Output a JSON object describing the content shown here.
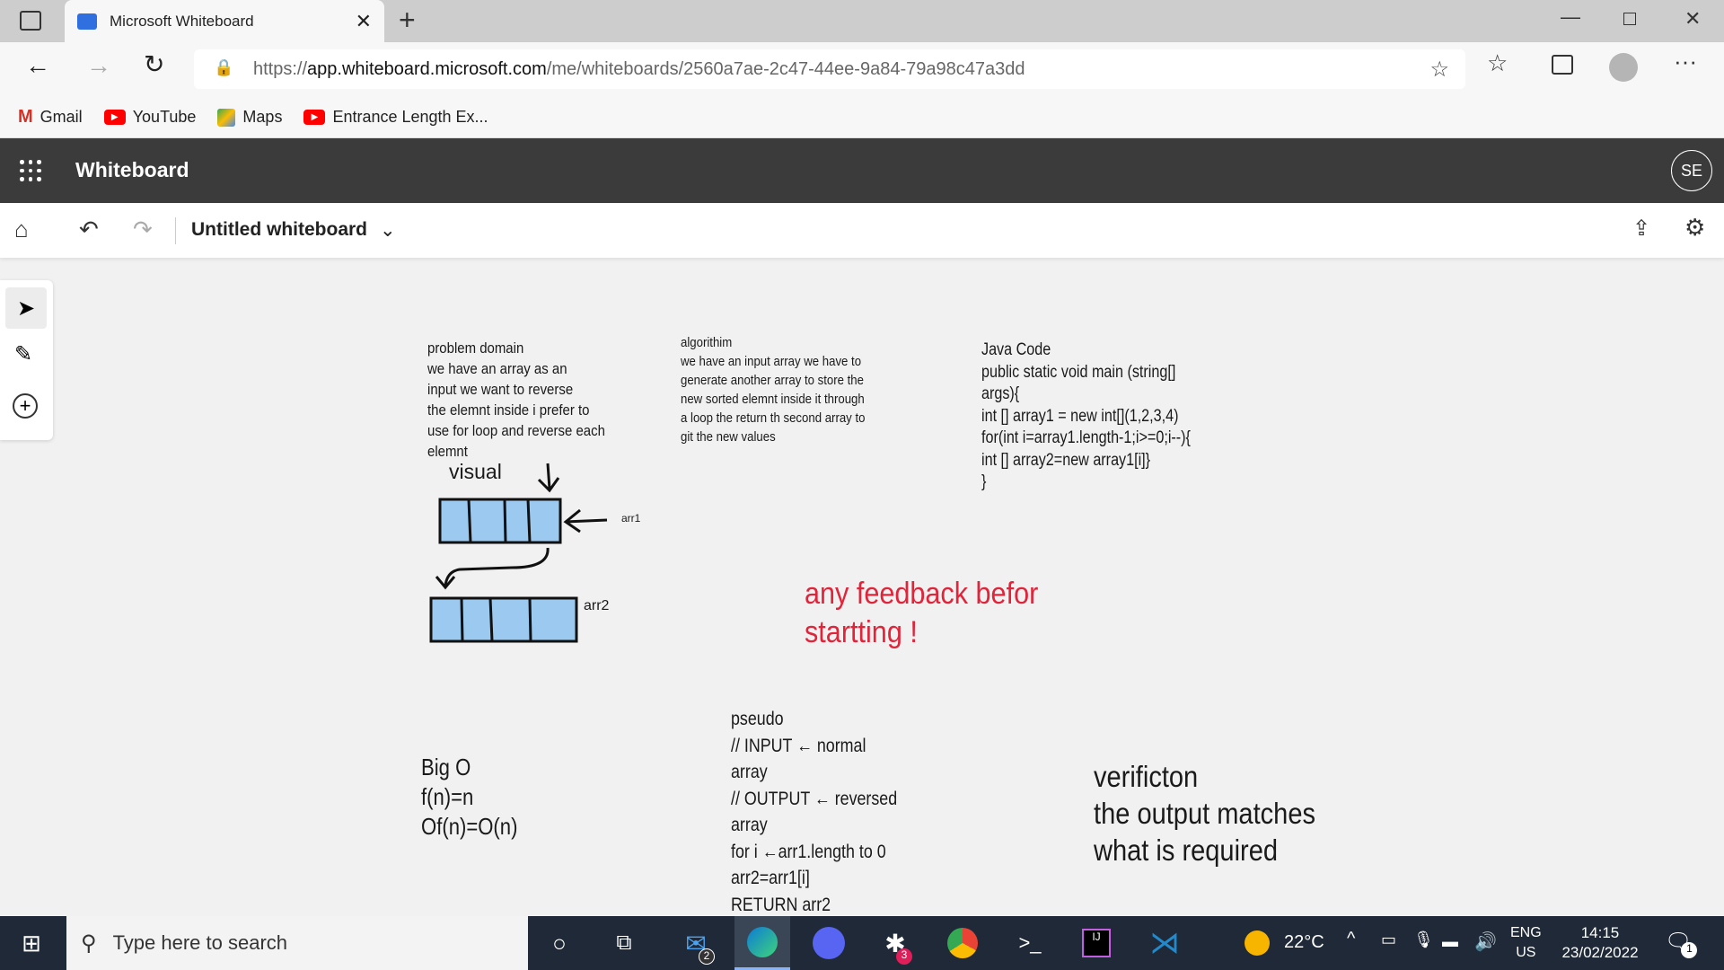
{
  "browser": {
    "tab_title": "Microsoft Whiteboard",
    "url_prefix": "https://",
    "url_host": "app.whiteboard.microsoft.com",
    "url_path": "/me/whiteboards/2560a7ae-2c47-44ee-9a84-79a98c47a3dd",
    "bookmarks": [
      {
        "label": "Gmail",
        "icon": "gmail-icon"
      },
      {
        "label": "YouTube",
        "icon": "youtube-icon"
      },
      {
        "label": "Maps",
        "icon": "maps-icon"
      },
      {
        "label": "Entrance Length Ex...",
        "icon": "youtube-icon"
      }
    ]
  },
  "app": {
    "name": "Whiteboard",
    "avatar": "SE",
    "board_title": "Untitled whiteboard"
  },
  "canvas": {
    "problem": [
      "problem domain",
      "we have an array as an",
      "input we want to reverse",
      "the elemnt inside i prefer to",
      "use for loop and reverse each",
      "elemnt"
    ],
    "algorithm": [
      "algorithim",
      "we have an input array we have to",
      "generate another array to store the",
      "new sorted elemnt inside it through",
      "a loop the return th second array to",
      "git the new values"
    ],
    "java": [
      "Java Code",
      "public static void main (string[]",
      "args){",
      "int [] array1 = new int[](1,2,3,4)",
      "for(int i=array1.length-1;i>=0;i--){",
      "int [] array2=new array1[i]}",
      "}"
    ],
    "visual_label": "visual",
    "arr1_label": "arr1",
    "arr2_label": "arr2",
    "feedback": [
      "any feedback befor",
      "startting !"
    ],
    "feedback_color": "#e0243a",
    "pseudo": [
      "pseudo",
      "// INPUT ← normal",
      "array",
      "// OUTPUT ← reversed",
      "array",
      "for i ←arr1.length to 0",
      "arr2=arr1[i]",
      "RETURN arr2"
    ],
    "bigo": [
      "Big O",
      "f(n)=n",
      "Of(n)=O(n)"
    ],
    "verification": [
      "verificton",
      "the output matches",
      "what is required"
    ],
    "array_fill": "#9cc9f0"
  },
  "taskbar": {
    "search_placeholder": "Type here to search",
    "mail_badge": "2",
    "slack_badge": "3",
    "weather": "22°C",
    "lang1": "ENG",
    "lang2": "US",
    "time": "14:15",
    "date": "23/02/2022",
    "notif_badge": "1"
  }
}
